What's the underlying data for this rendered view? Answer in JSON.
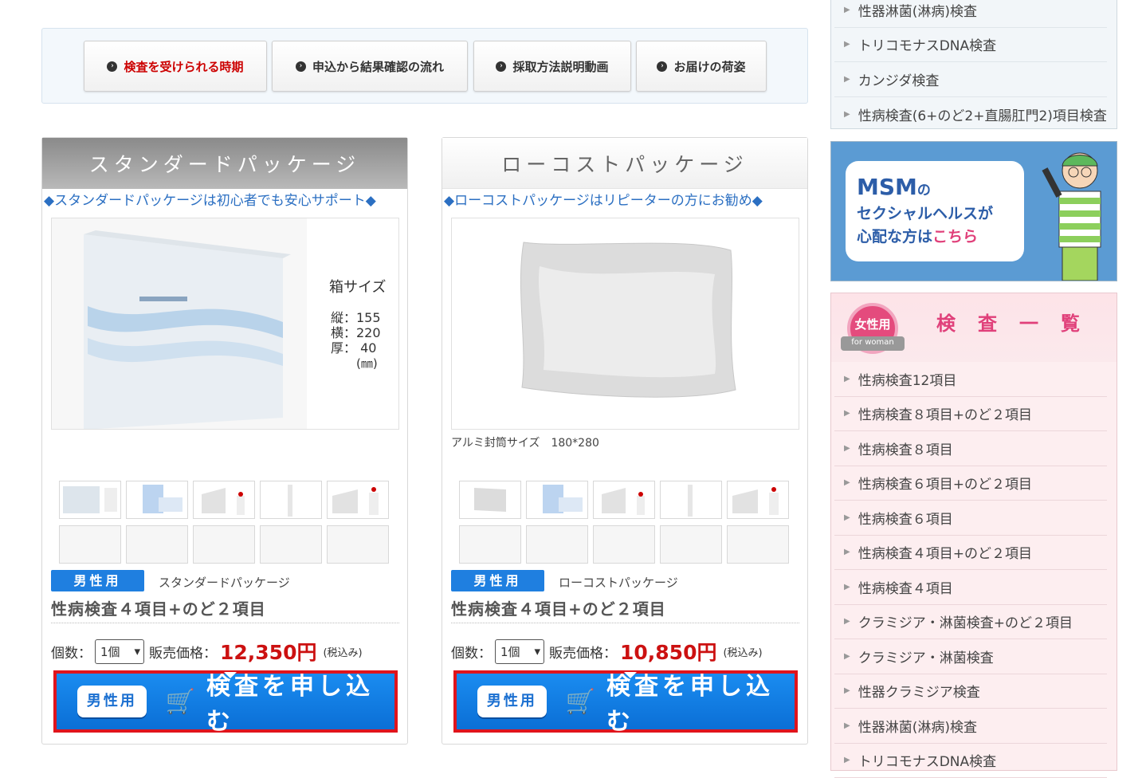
{
  "nav": {
    "buttons": [
      {
        "label": "検査を受けられる時期"
      },
      {
        "label": "申込から結果確認の流れ"
      },
      {
        "label": "採取方法説明動画"
      },
      {
        "label": "お届けの荷姿"
      }
    ]
  },
  "products": [
    {
      "header": "スタンダードパッケージ",
      "tagline": "◆スタンダードパッケージは初心者でも安心サポート◆",
      "box_size": {
        "title": "箱サイズ",
        "l1": "縦：155",
        "l2": "横：220",
        "l3": "厚：  40",
        "unit": "(㎜)"
      },
      "badge": "男性用",
      "package_name": "スタンダードパッケージ",
      "title": "性病検査４項目+のど２項目",
      "qty_label": "個数：",
      "qty_value": "1個",
      "price_label": "販売価格：",
      "price": "12,350円",
      "tax": "(税込み)",
      "apply_badge": "男性用",
      "apply_label": "検査を申し込む"
    },
    {
      "header": "ローコストパッケージ",
      "tagline": "◆ローコストパッケージはリピーターの方にお勧め◆",
      "caption": "アルミ封筒サイズ　180*280",
      "badge": "男性用",
      "package_name": "ローコストパッケージ",
      "title": "性病検査４項目+のど２項目",
      "qty_label": "個数：",
      "qty_value": "1個",
      "price_label": "販売価格：",
      "price": "10,850円",
      "tax": "(税込み)",
      "apply_badge": "男性用",
      "apply_label": "検査を申し込む"
    }
  ],
  "sidebar_men": {
    "items": [
      "性器淋菌(淋病)検査",
      "トリコモナスDNA検査",
      "カンジダ検査",
      "性病検査(6+のど2+直腸肛門2)項目検査"
    ]
  },
  "msm_banner": {
    "line1": "MSM",
    "line1_small": "の",
    "line2": "セクシャルヘルスが",
    "line3_a": "心配な方は",
    "line3_b": "こちら"
  },
  "sidebar_women": {
    "badge": "女性用",
    "badge_sub": "for woman",
    "title": "検査一覧",
    "items": [
      "性病検査12項目",
      "性病検査８項目+のど２項目",
      "性病検査８項目",
      "性病検査６項目+のど２項目",
      "性病検査６項目",
      "性病検査４項目+のど２項目",
      "性病検査４項目",
      "クラミジア・淋菌検査+のど２項目",
      "クラミジア・淋菌検査",
      "性器クラミジア検査",
      "性器淋菌(淋病)検査",
      "トリコモナスDNA検査"
    ]
  },
  "colors": {
    "accent_red": "#cc1111",
    "button_blue": "#1a8cf0",
    "women_pink": "#e0407a"
  }
}
